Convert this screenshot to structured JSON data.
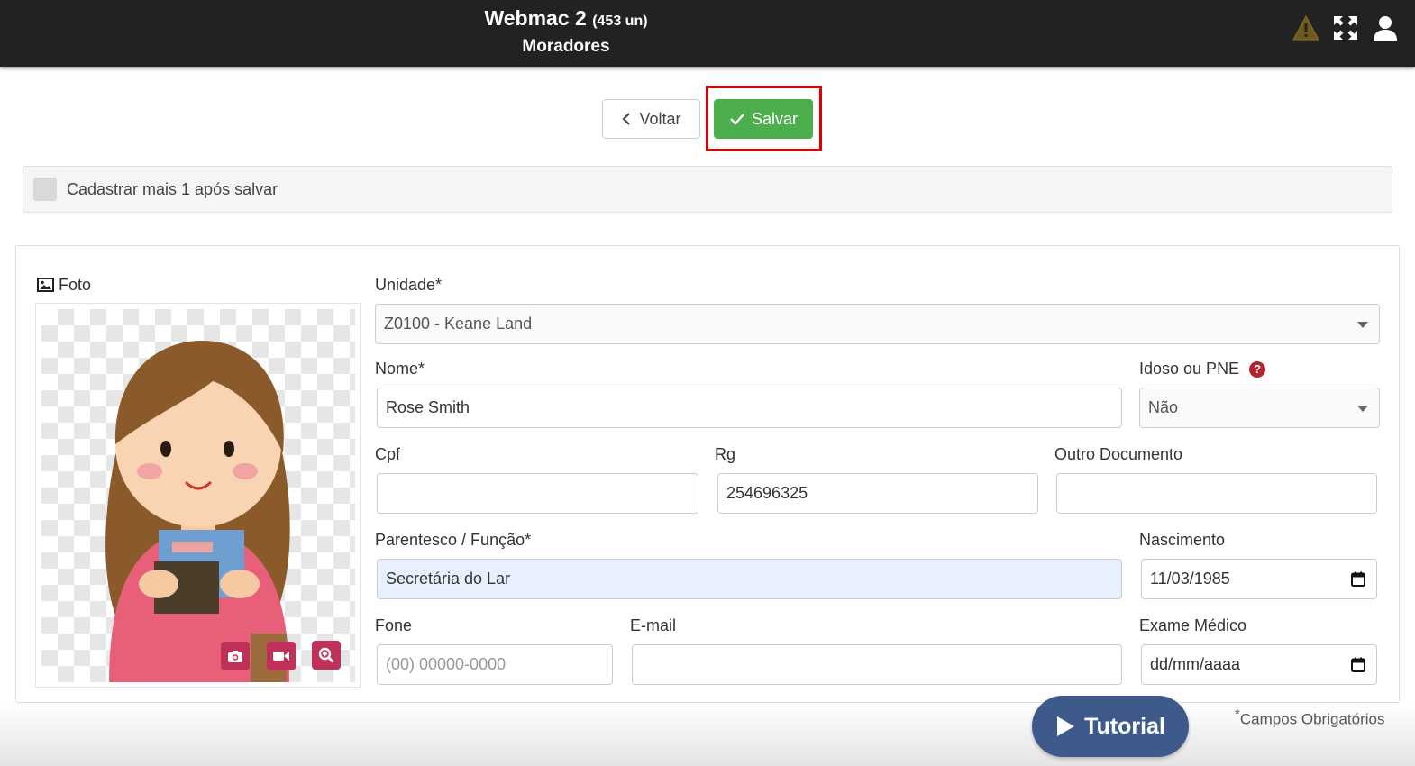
{
  "header": {
    "app_title": "Webmac 2",
    "units": "(453 un)",
    "subtitle": "Moradores",
    "icons": [
      "warning-icon",
      "expand-icon",
      "user-icon"
    ]
  },
  "toolbar": {
    "back_label": "Voltar",
    "save_label": "Salvar"
  },
  "options": {
    "register_more_label": "Cadastrar mais 1 após salvar",
    "register_more_checked": false
  },
  "photo": {
    "label": "Foto",
    "buttons": [
      "camera-icon",
      "video-icon",
      "zoom-in-icon"
    ]
  },
  "form": {
    "unidade": {
      "label": "Unidade*",
      "value": "Z0100 - Keane Land"
    },
    "nome": {
      "label": "Nome*",
      "value": "Rose Smith"
    },
    "idoso": {
      "label": "Idoso ou PNE",
      "help": "?",
      "value": "Não"
    },
    "cpf": {
      "label": "Cpf",
      "value": ""
    },
    "rg": {
      "label": "Rg",
      "value": "254696325"
    },
    "outro_doc": {
      "label": "Outro Documento",
      "value": ""
    },
    "parentesco": {
      "label": "Parentesco / Função*",
      "value": "Secretária do Lar"
    },
    "nascimento": {
      "label": "Nascimento",
      "value": "11/03/1985"
    },
    "fone": {
      "label": "Fone",
      "placeholder": "(00) 00000-0000",
      "value": ""
    },
    "email": {
      "label": "E-mail",
      "value": ""
    },
    "exame": {
      "label": "Exame Médico",
      "placeholder": "dd/mm/aaaa"
    }
  },
  "footer": {
    "tutorial_label": "Tutorial",
    "required_mark": "*",
    "required_note": "Campos Obrigatórios"
  },
  "colors": {
    "header_bg": "#222222",
    "save_green": "#4cae4c",
    "highlight_red": "#e00000",
    "photo_btn": "#c0315a",
    "tutorial_blue": "#3d5a8a"
  }
}
